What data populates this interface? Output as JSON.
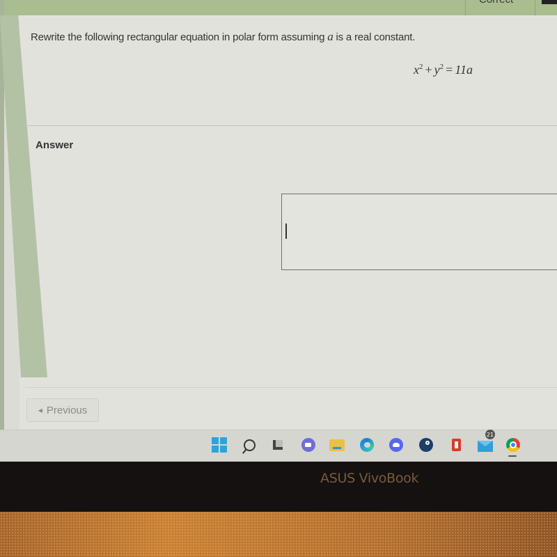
{
  "header": {
    "status_label": "Correct"
  },
  "question": {
    "prompt_before": "Rewrite the following rectangular equation in polar form assuming ",
    "variable": "a",
    "prompt_after": " is a real constant.",
    "equation": {
      "lhs_x": "x",
      "lhs_y": "y",
      "exp": "2",
      "plus": "+",
      "equals": "=",
      "rhs": "11a"
    }
  },
  "answer": {
    "label": "Answer",
    "value": ""
  },
  "navigation": {
    "previous_label": "Previous",
    "previous_icon": "triangle-left-icon"
  },
  "taskbar": {
    "icons": [
      "windows-start-icon",
      "search-icon",
      "task-view-icon",
      "teams-chat-icon",
      "file-explorer-icon",
      "edge-icon",
      "discord-icon",
      "steam-icon",
      "office-icon",
      "mail-icon",
      "chrome-icon"
    ],
    "mail_badge": "21",
    "active_app": "chrome"
  },
  "device": {
    "brand_text": "ASUS VivoBook"
  }
}
